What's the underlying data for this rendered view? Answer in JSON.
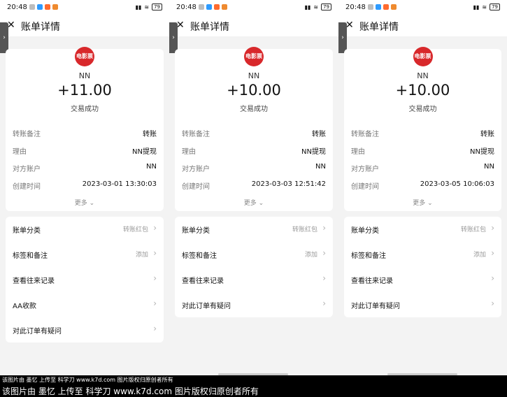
{
  "status": {
    "time": "20:48",
    "battery": "79",
    "icon_colors": [
      "#bdbdbd",
      "#2e9bff",
      "#ff6b2f",
      "#ef8a2f"
    ]
  },
  "header": {
    "title": "账单详情"
  },
  "tab_glyph": "›",
  "details": {
    "keys": {
      "memo": "转账备注",
      "reason": "理由",
      "account": "对方账户",
      "created": "创建时间"
    },
    "logo_text": "电影票",
    "more": "更多"
  },
  "panels": [
    {
      "name": "NN",
      "amount": "+11.00",
      "result": "交易成功",
      "memo": "转账",
      "reason": "NN提现",
      "account": "NN",
      "created": "2023-03-01 13:30:03",
      "actions": [
        {
          "label": "账单分类",
          "value": "转账红包"
        },
        {
          "label": "标签和备注",
          "value": "添加"
        },
        {
          "label": "查看往来记录",
          "value": ""
        },
        {
          "label": "AA收款",
          "value": ""
        },
        {
          "label": "对此订单有疑问",
          "value": ""
        }
      ]
    },
    {
      "name": "NN",
      "amount": "+10.00",
      "result": "交易成功",
      "memo": "转账",
      "reason": "NN提现",
      "account": "NN",
      "created": "2023-03-03 12:51:42",
      "actions": [
        {
          "label": "账单分类",
          "value": "转账红包"
        },
        {
          "label": "标签和备注",
          "value": "添加"
        },
        {
          "label": "查看往来记录",
          "value": ""
        },
        {
          "label": "对此订单有疑问",
          "value": ""
        }
      ]
    },
    {
      "name": "NN",
      "amount": "+10.00",
      "result": "交易成功",
      "memo": "转账",
      "reason": "NN提现",
      "account": "NN",
      "created": "2023-03-05 10:06:03",
      "actions": [
        {
          "label": "账单分类",
          "value": "转账红包"
        },
        {
          "label": "标签和备注",
          "value": "添加"
        },
        {
          "label": "查看往来记录",
          "value": ""
        },
        {
          "label": "对此订单有疑问",
          "value": ""
        }
      ]
    }
  ],
  "watermark": {
    "line1": "该图片由 墨忆 上传至 科学刀 www.k7d.com 图片版权归原创者所有",
    "line2": "该图片由 墨忆 上传至 科学刀 www.k7d.com 图片版权归原创者所有"
  }
}
